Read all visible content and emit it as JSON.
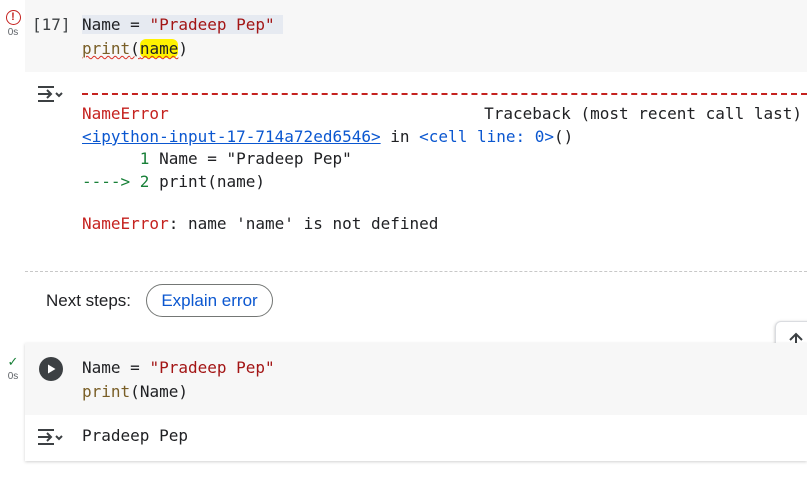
{
  "cell1": {
    "status": "error",
    "exec_time": "0s",
    "exec_count": "[17]",
    "line1": {
      "var": "Name",
      "op": " = ",
      "str": "\"Pradeep Pep\""
    },
    "line2": {
      "fn": "print",
      "open": "(",
      "arg": "name",
      "close": ")"
    }
  },
  "output1": {
    "error_name": "NameError",
    "traceback_header": "Traceback (most recent call last)",
    "location_link": "<ipython-input-17-714a72ed6546>",
    "in_text": " in ",
    "cell_line": "<cell line: 0>",
    "cell_line_parens": "()",
    "tb_line1_num": "      1",
    "tb_line1_code": " Name = \"Pradeep Pep\"",
    "tb_line2_arrow": "---->",
    "tb_line2_num": " 2",
    "tb_line2_code": " print(name)",
    "error_message": ": name 'name' is not defined"
  },
  "next_steps": {
    "label": "Next steps:",
    "button": "Explain error"
  },
  "cell2": {
    "status": "success",
    "exec_time": "0s",
    "line1": {
      "var": "Name",
      "op": " = ",
      "str": "\"Pradeep Pep\""
    },
    "line2": {
      "fn": "print",
      "open": "(",
      "arg": "Name",
      "close": ")"
    }
  },
  "output2": {
    "text": "Pradeep Pep"
  },
  "icons": {
    "error": "error-circle-icon",
    "success": "check-icon",
    "run": "play-icon",
    "output": "output-toggle-icon",
    "scroll": "arrow-up-icon"
  },
  "colors": {
    "error": "#c5221f",
    "string": "#a31515",
    "function": "#795e26",
    "link": "#0b57d0",
    "success": "#188038",
    "highlight": "#fff200"
  }
}
